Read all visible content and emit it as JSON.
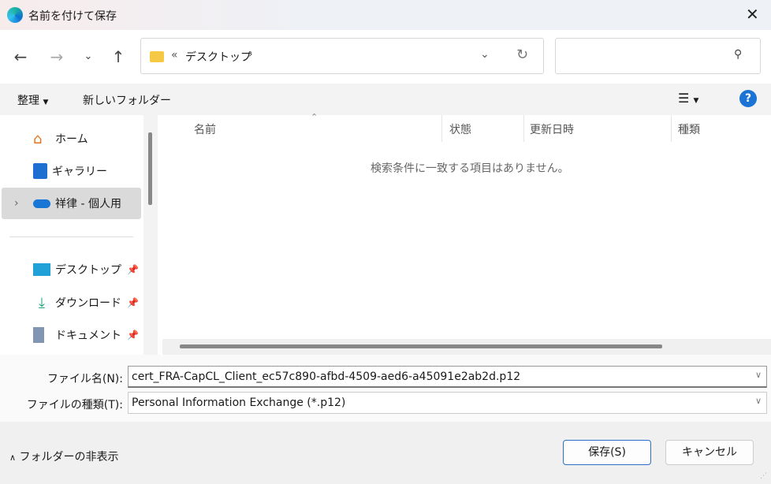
{
  "title": "名前を付けて保存",
  "nav": {
    "path_prefix": "«",
    "location": "デスクトップ",
    "search_placeholder": ""
  },
  "toolbar": {
    "organize": "整理",
    "new_folder": "新しいフォルダー"
  },
  "sidebar": {
    "items": [
      {
        "label": "ホーム",
        "icon": "home-icon"
      },
      {
        "label": "ギャラリー",
        "icon": "gallery-icon"
      },
      {
        "label": "祥律 - 個人用",
        "icon": "onedrive-icon"
      },
      {
        "label": "デスクトップ",
        "icon": "desktop-icon"
      },
      {
        "label": "ダウンロード",
        "icon": "download-icon"
      },
      {
        "label": "ドキュメント",
        "icon": "documents-icon"
      }
    ]
  },
  "columns": [
    "名前",
    "状態",
    "更新日時",
    "種類"
  ],
  "empty_message": "検索条件に一致する項目はありません。",
  "form": {
    "filename_label": "ファイル名(N):",
    "filename_value": "cert_FRA-CapCL_Client_ec57c890-afbd-4509-aed6-a45091e2ab2d.p12",
    "type_label": "ファイルの種類(T):",
    "type_value": "Personal Information Exchange (*.p12)"
  },
  "footer": {
    "hide_folders": "フォルダーの非表示",
    "save": "保存(S)",
    "cancel": "キャンセル"
  }
}
